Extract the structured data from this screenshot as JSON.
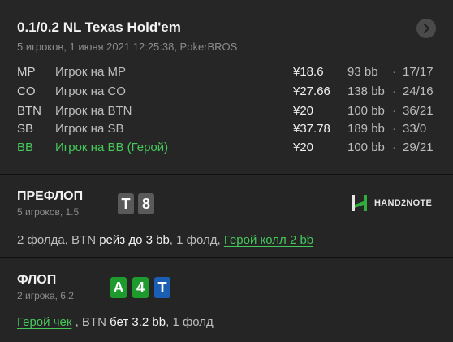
{
  "header": {
    "title": "0.1/0.2 NL Texas Hold'em",
    "subtitle": "5 игроков, 1 июня 2021 12:25:38, PokerBROS"
  },
  "players": [
    {
      "pos": "MP",
      "name": "Игрок на MP",
      "stack": "¥18.6",
      "bb": "93 bb",
      "sep": "·",
      "stat": "17/17"
    },
    {
      "pos": "CO",
      "name": "Игрок на CO",
      "stack": "¥27.66",
      "bb": "138 bb",
      "sep": "·",
      "stat": "24/16"
    },
    {
      "pos": "BTN",
      "name": "Игрок на BTN",
      "stack": "¥20",
      "bb": "100 bb",
      "sep": "·",
      "stat": "36/21"
    },
    {
      "pos": "SB",
      "name": "Игрок на SB",
      "stack": "¥37.78",
      "bb": "189 bb",
      "sep": "·",
      "stat": "33/0"
    },
    {
      "pos": "BB",
      "name": "Игрок на BB (Герой)",
      "stack": "¥20",
      "bb": "100 bb",
      "sep": "·",
      "stat": "29/21"
    }
  ],
  "preflop": {
    "title": "ПРЕФЛОП",
    "subtitle": "5 игроков, 1.5",
    "cards": [
      {
        "rank": "T",
        "color": "#5a5a5a"
      },
      {
        "rank": "8",
        "color": "#5a5a5a"
      }
    ],
    "actions": {
      "a1": "2 фолда, BTN ",
      "a2": "рейз до 3 bb",
      "a3": ", 1 фолд, ",
      "a4": "Герой колл 2 bb"
    },
    "logo_text": "HAND2NOTE"
  },
  "flop": {
    "title": "ФЛОП",
    "subtitle": "2 игрока, 6.2",
    "cards": [
      {
        "rank": "A",
        "color": "#1e9b2d"
      },
      {
        "rank": "4",
        "color": "#1e9b2d"
      },
      {
        "rank": "T",
        "color": "#1a5fb4"
      }
    ],
    "actions": {
      "a1": "Герой чек",
      "a2": " , BTN ",
      "a3": "бет 3.2 bb",
      "a4": ", 1 фолд"
    }
  },
  "colors": {
    "hero": "#45c85a",
    "logo_green": "#2fae3f"
  },
  "icons": {
    "header_button": "chevron-right-icon",
    "logo": "hand2note-logo-icon"
  }
}
